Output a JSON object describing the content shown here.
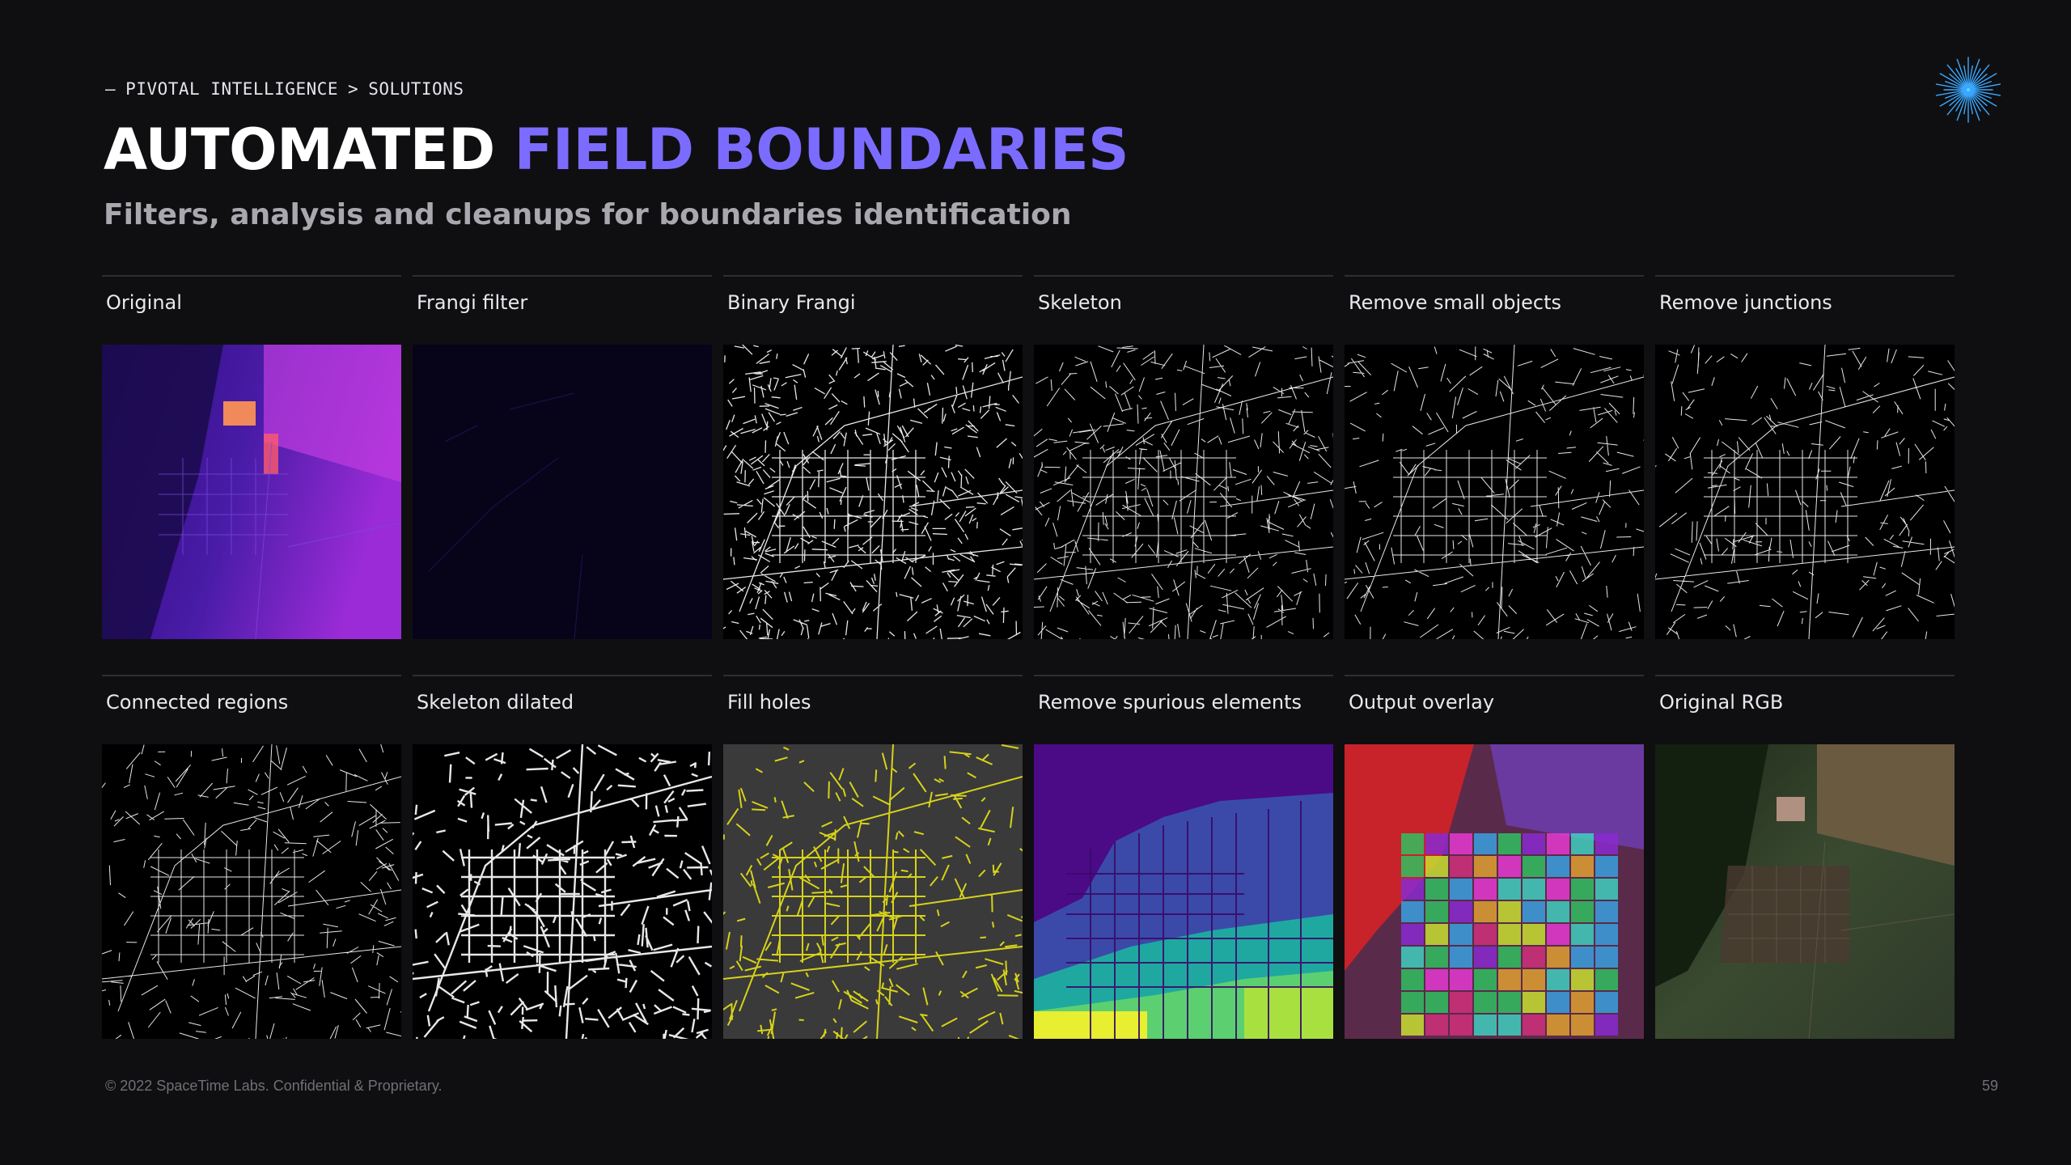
{
  "breadcrumb": {
    "dash": "—",
    "root": "PIVOTAL INTELLIGENCE",
    "sep": ">",
    "current": "SOLUTIONS"
  },
  "title": {
    "plain": "AUTOMATED",
    "accent": "FIELD BOUNDARIES"
  },
  "subtitle": "Filters, analysis and cleanups for boundaries identification",
  "panels": [
    {
      "label": "Original"
    },
    {
      "label": "Frangi filter"
    },
    {
      "label": "Binary Frangi"
    },
    {
      "label": "Skeleton"
    },
    {
      "label": "Remove small objects"
    },
    {
      "label": "Remove junctions"
    },
    {
      "label": "Connected regions"
    },
    {
      "label": "Skeleton dilated"
    },
    {
      "label": "Fill holes"
    },
    {
      "label": "Remove spurious elements"
    },
    {
      "label": "Output overlay"
    },
    {
      "label": "Original RGB"
    }
  ],
  "footer": "© 2022 SpaceTime Labs. Confidential & Proprietary.",
  "page_number": "59",
  "colors": {
    "background": "#0f0f11",
    "accent": "#7b6cff",
    "logo": "#3aa8ff"
  }
}
